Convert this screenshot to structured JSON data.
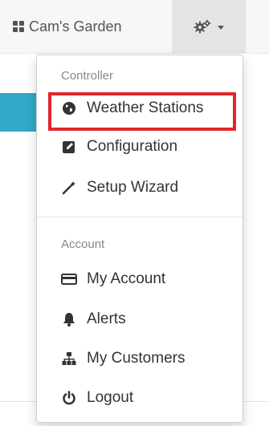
{
  "navbar": {
    "garden_name": "Cam's Garden",
    "garden_icon": "grid-icon",
    "settings_icon": "gears-icon",
    "settings_toggle_icon": "caret-down-icon"
  },
  "dropdown": {
    "sections": [
      {
        "header": "Controller",
        "items": [
          {
            "label": "Weather Stations",
            "icon": "globe-icon",
            "highlighted": true
          },
          {
            "label": "Configuration",
            "icon": "edit-icon"
          },
          {
            "label": "Setup Wizard",
            "icon": "magic-wand-icon"
          }
        ]
      },
      {
        "header": "Account",
        "items": [
          {
            "label": "My Account",
            "icon": "credit-card-icon"
          },
          {
            "label": "Alerts",
            "icon": "bell-icon"
          },
          {
            "label": "My Customers",
            "icon": "sitemap-icon"
          },
          {
            "label": "Logout",
            "icon": "power-icon"
          }
        ]
      }
    ]
  },
  "colors": {
    "highlight_border": "#e3262b",
    "accent_teal": "#32a8c6",
    "navbar_bg": "#f7f7f7",
    "toggle_bg": "#e4e4e4"
  }
}
